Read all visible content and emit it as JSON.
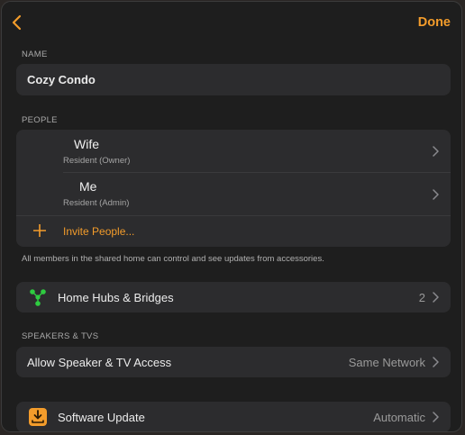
{
  "header": {
    "done_label": "Done"
  },
  "name_section": {
    "label": "NAME",
    "value": "Cozy Condo"
  },
  "people_section": {
    "label": "PEOPLE",
    "members": [
      {
        "name": "Wife",
        "role": "Resident (Owner)"
      },
      {
        "name": "Me",
        "role": "Resident (Admin)"
      }
    ],
    "invite_label": "Invite People...",
    "footnote": "All members in the shared home can control and see updates from accessories."
  },
  "hubs": {
    "label": "Home Hubs & Bridges",
    "count": "2",
    "icon": "hub-network-icon"
  },
  "speakers_section": {
    "label": "SPEAKERS & TVS",
    "access_label": "Allow Speaker & TV Access",
    "access_value": "Same Network"
  },
  "software_update": {
    "label": "Software Update",
    "value": "Automatic",
    "icon": "download-icon"
  },
  "colors": {
    "accent": "#f39c2b",
    "hub_green": "#2ecc40",
    "card_bg": "#2c2c2e",
    "window_bg": "#1e1e1e"
  }
}
